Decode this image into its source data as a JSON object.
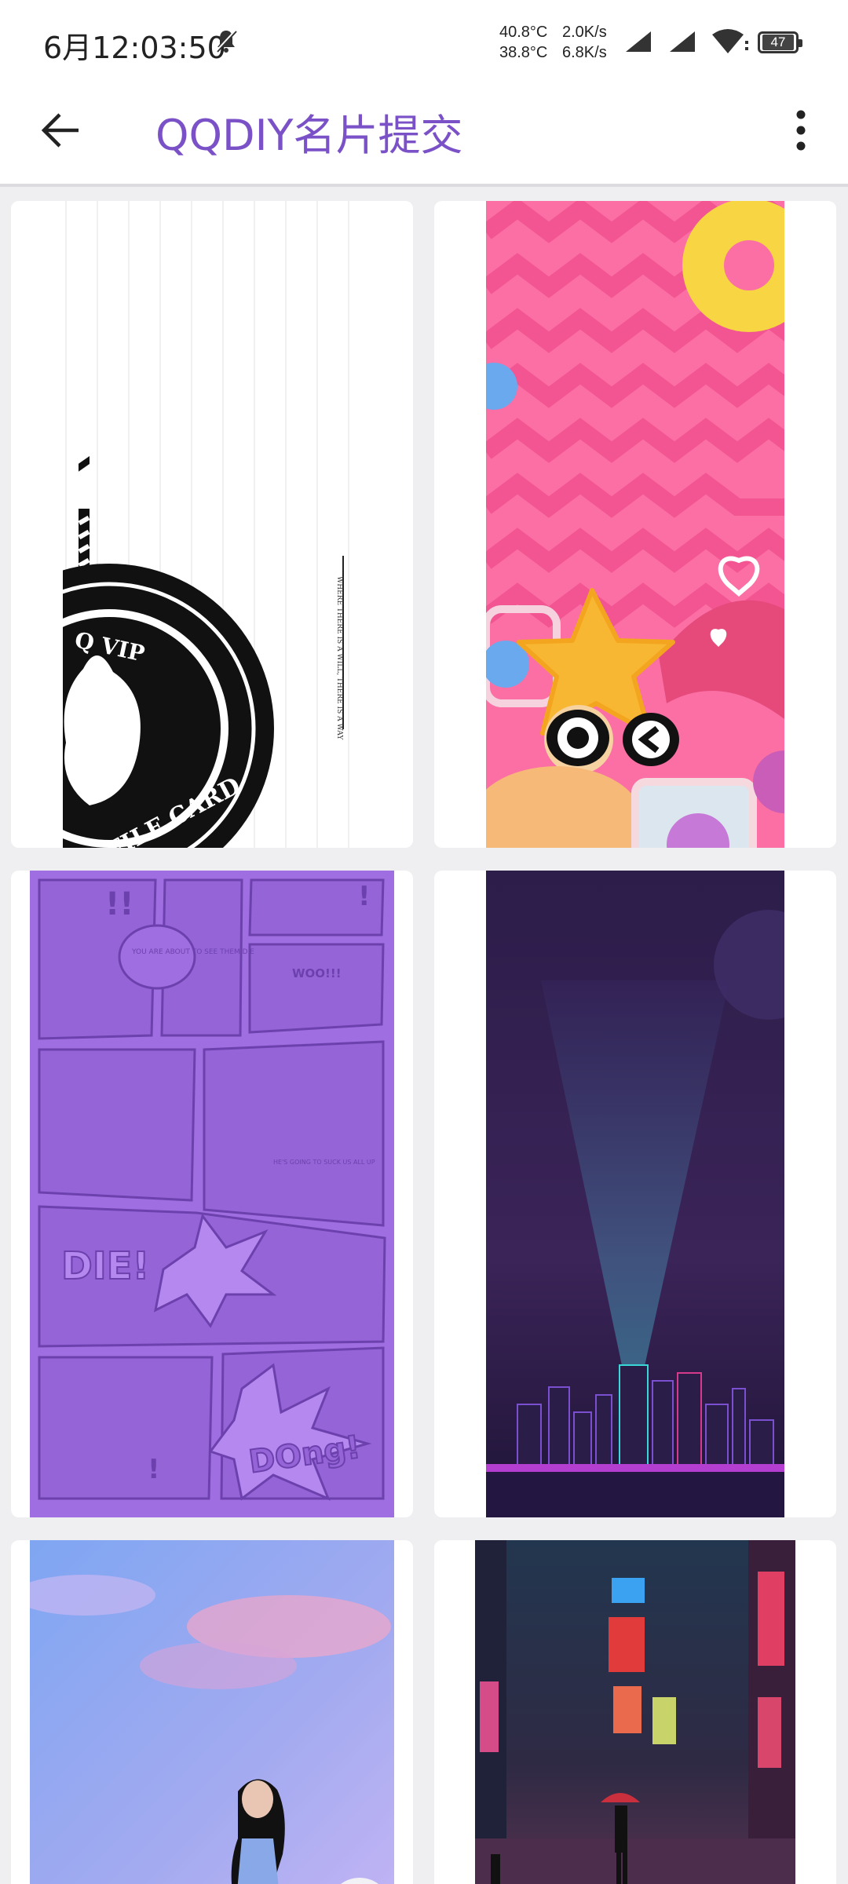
{
  "status_bar": {
    "time": "6月12:03:50",
    "temp_1": "40.8°C",
    "temp_2": "38.8°C",
    "speed_up": "2.0K/s",
    "speed_down": "6.8K/s",
    "battery": "47"
  },
  "app_bar": {
    "title": "QQDIY名片提交",
    "back_icon": "arrow-left-icon",
    "menu_icon": "more-vertical-icon"
  },
  "cards": [
    {
      "name": "qq-vip-profile-card",
      "caption_1": "Q VIP",
      "caption_2": "PROFILE CARD",
      "side_text": "WHERE THERE IS A WILL, THERE IS A WAY"
    },
    {
      "name": "pink-star-card"
    },
    {
      "name": "purple-comic-card",
      "text_1": "YOU ARE ABOUT TO SEE THEM DIE",
      "text_2": "WOO!!!",
      "text_3": "HE'S GOING TO SUCK US ALL UP",
      "text_4": "DIE!",
      "text_5": "DOng!"
    },
    {
      "name": "neon-city-card"
    },
    {
      "name": "girl-sky-card"
    },
    {
      "name": "rainy-street-card"
    }
  ],
  "colors": {
    "accent": "#7b51c7",
    "background": "#efeff2",
    "comic_purple": "#9f6ee0"
  }
}
